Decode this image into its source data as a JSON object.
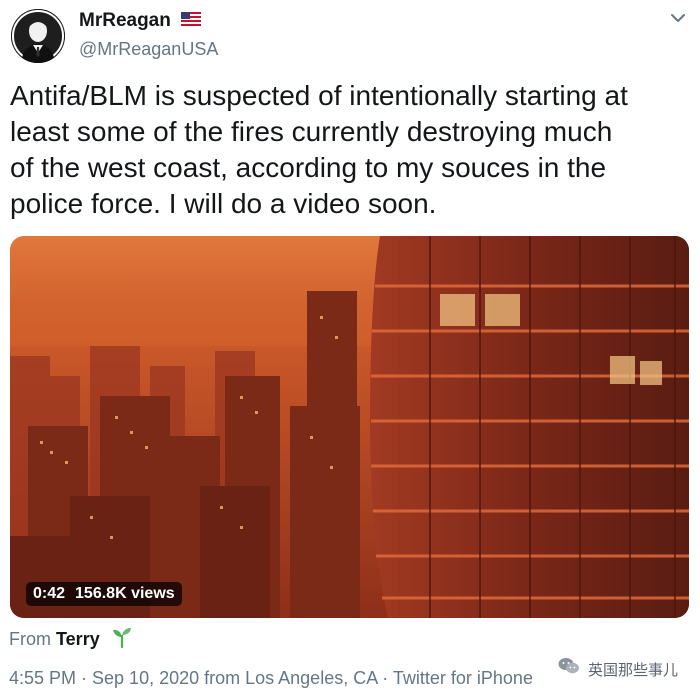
{
  "user": {
    "display_name": "MrReagan",
    "handle": "@MrReaganUSA",
    "flag_icon": "us-flag-icon",
    "avatar_icon": "reagan-portrait-avatar"
  },
  "tweet": {
    "text": "Antifa/BLM is suspected of intentionally starting at\nleast some of the fires currently destroying much\nof the west coast, according to my souces in the\npolice force. I will do a video soon."
  },
  "media": {
    "type": "video",
    "duration": "0:42",
    "views": "156.8K views",
    "tint_color": "#c0502a"
  },
  "attribution": {
    "prefix": "From",
    "user": "Terry",
    "icon": "sprout-icon"
  },
  "meta": {
    "line": "4:55 PM · Sep 10, 2020 from Los Angeles, CA · Twitter for iPhone"
  },
  "watermark": {
    "text": "英国那些事儿",
    "icon": "wechat-icon"
  },
  "colors": {
    "text": "#14171a",
    "secondary": "#657786",
    "sprout_green": "#4caf50"
  }
}
